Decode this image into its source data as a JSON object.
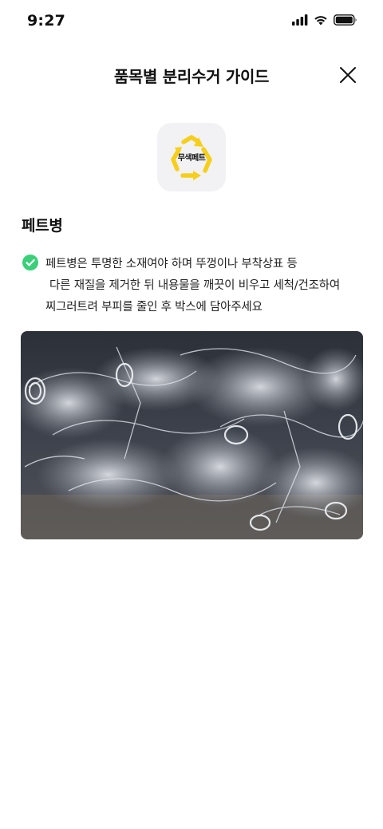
{
  "status_bar": {
    "time": "9:27"
  },
  "header": {
    "title": "품목별 분리수거 가이드"
  },
  "item": {
    "icon_label": "무색페트",
    "icon_name": "recycle-arrows-icon",
    "accent_color": "#f5cf1c",
    "name": "페트병",
    "guide_lines": [
      "페트병은 투명한 소재여야 하며 뚜껑이나 부착상표 등",
      "다른 재질을 제거한 뒤 내용물을 깨끗이 비우고 세척/건조하여",
      "찌그러트려 부피를 줄인 후 박스에 담아주세요"
    ],
    "check_color": "#3ccf7a"
  }
}
